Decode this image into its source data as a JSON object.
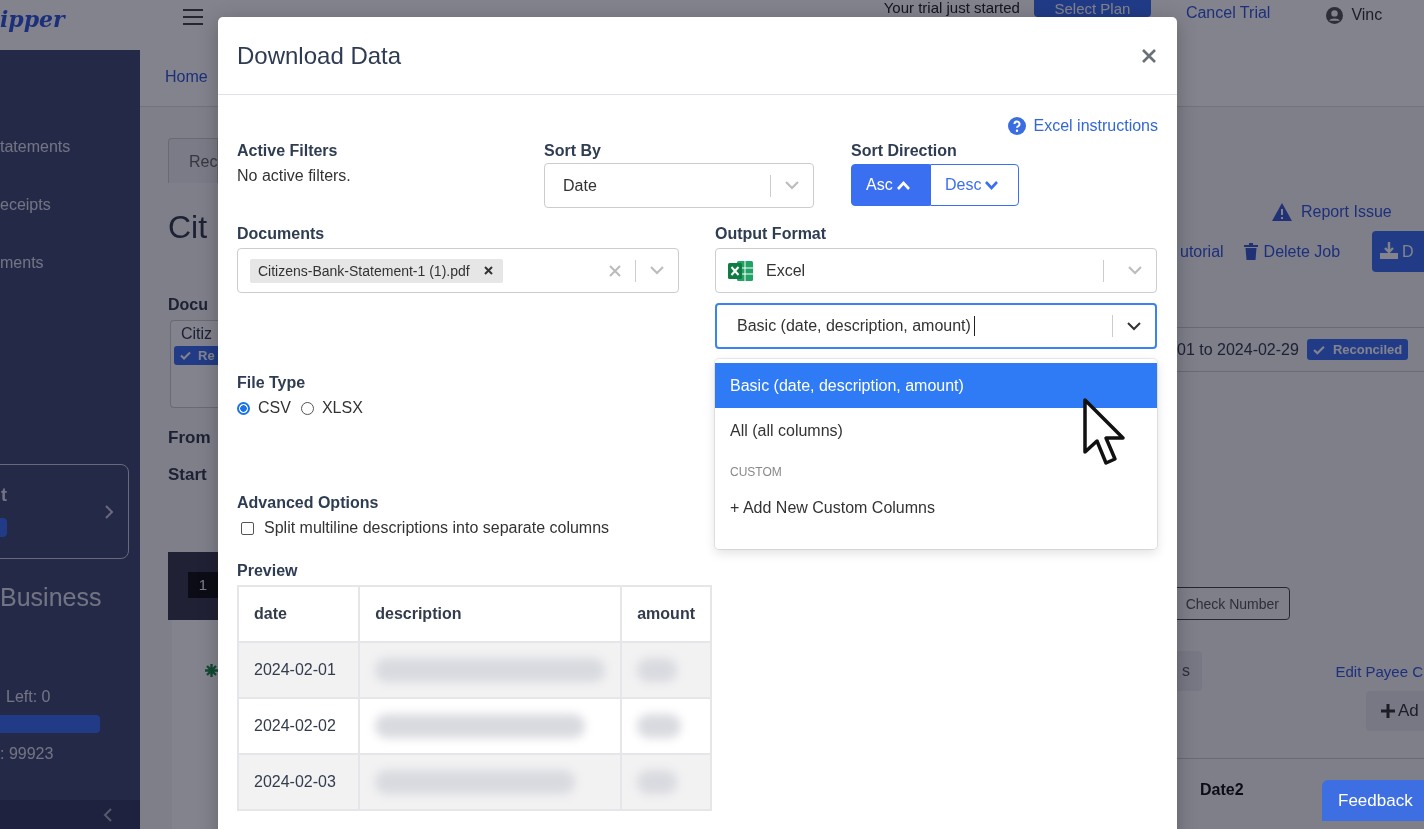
{
  "background": {
    "header": {
      "logo": "ipper",
      "trial_text": "Your trial just started",
      "select_plan": "Select Plan",
      "cancel_trial": "Cancel Trial",
      "user": "Vinc"
    },
    "sidebar": {
      "items": [
        "tatements",
        "eceipts",
        "ments"
      ],
      "card_title": "t",
      "card_bar": {
        "level": 1
      },
      "usage_bar": {
        "level": 1
      },
      "business": "Business",
      "pages_left": "Left: 0",
      "credits": ": 99923"
    },
    "breadcrumb": "Home",
    "left": {
      "tab": "Rec",
      "title": "Cit",
      "documents_label": "Docu",
      "document": "Citiz",
      "badge": "Re",
      "from_label": "From",
      "start_label": "Start",
      "page_number": "1"
    },
    "right": {
      "report_issue": "Report Issue",
      "tutorial": "utorial",
      "delete_job": "Delete Job",
      "download": "D",
      "date_range": "01 to 2024-02-29",
      "status": "Reconciled",
      "check_number": "Check Number",
      "grey_button": "s",
      "edit_payee": "Edit Payee C",
      "add": "Ad",
      "column": "Date2"
    }
  },
  "modal": {
    "title": "Download Data",
    "help_link": "Excel instructions",
    "active_filters": {
      "label": "Active Filters",
      "text": "No active filters."
    },
    "sort_by": {
      "label": "Sort By",
      "value": "Date"
    },
    "sort_direction": {
      "label": "Sort Direction",
      "buttons": [
        {
          "label": "Asc",
          "selected": true
        },
        {
          "label": "Desc",
          "selected": false
        }
      ]
    },
    "documents": {
      "label": "Documents",
      "chips": [
        "Citizens-Bank-Statement-1 (1).pdf"
      ]
    },
    "output_format": {
      "label": "Output Format",
      "value": "Excel",
      "columns_select": {
        "value": "Basic (date, description, amount)",
        "focused": true,
        "options": [
          {
            "kind": "option",
            "label": "Basic (date, description, amount)",
            "selected": true
          },
          {
            "kind": "option",
            "label": "All (all columns)",
            "selected": false
          },
          {
            "kind": "group",
            "label": "CUSTOM"
          },
          {
            "kind": "action",
            "label": "+ Add New Custom Columns"
          }
        ]
      }
    },
    "file_type": {
      "label": "File Type",
      "options": [
        {
          "label": "CSV",
          "selected": true
        },
        {
          "label": "XLSX",
          "selected": false
        }
      ]
    },
    "advanced": {
      "label": "Advanced Options",
      "checkbox": {
        "label": "Split multiline descriptions into separate columns",
        "checked": false
      }
    },
    "preview": {
      "label": "Preview",
      "columns": [
        "date",
        "description",
        "amount"
      ],
      "rows": [
        {
          "date": "2024-02-01"
        },
        {
          "date": "2024-02-02"
        },
        {
          "date": "2024-02-03"
        }
      ]
    }
  },
  "feedback": "Feedback"
}
